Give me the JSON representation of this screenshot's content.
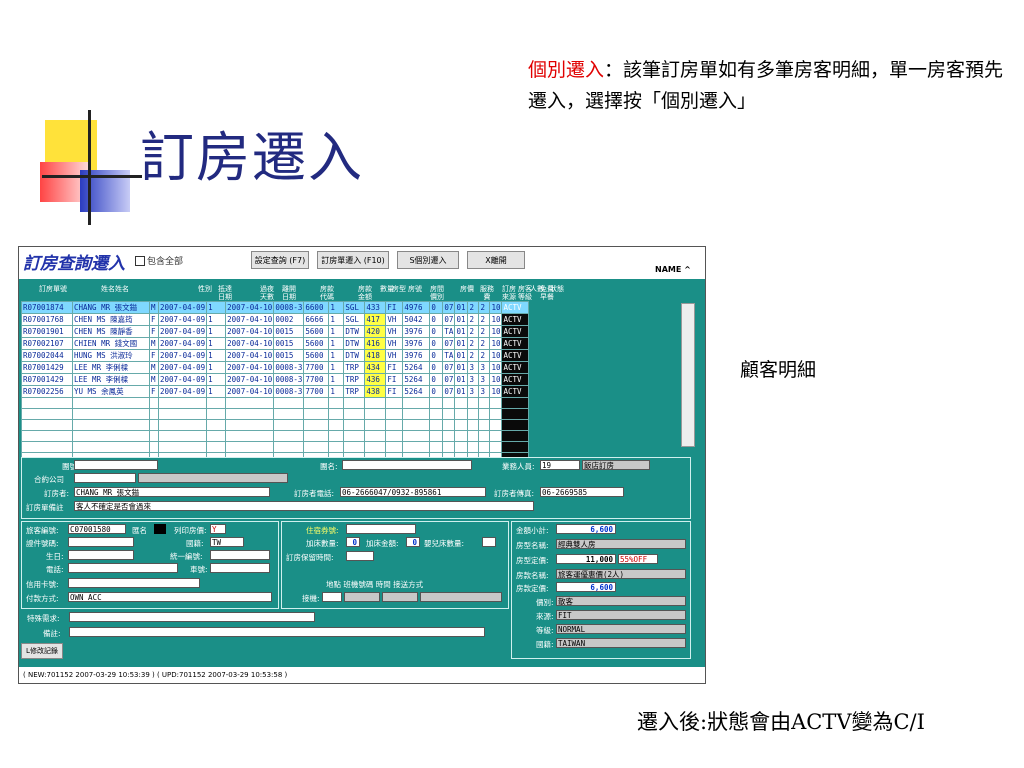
{
  "slide": {
    "title": "訂房遷入",
    "note_top_red": "個別遷入",
    "note_top_rest": "：該筆訂房單如有多筆房客明細，單一房客預先遷入，選擇按「個別遷入」",
    "note_right": "顧客明細",
    "note_bottom": "遷入後:狀態會由ACTV變為C/I"
  },
  "app": {
    "title": "訂房查詢遷入",
    "include_all_label": "包含全部",
    "buttons": {
      "settings": "設定查詢 (F7)",
      "booking_checkin": "訂房單遷入 (F10)",
      "individual_checkin": "S個別遷入",
      "leave": "X離開"
    },
    "name_label": "NAME ^",
    "columns": [
      "訂房單號",
      "姓名姓名",
      "性別",
      "抵達日期",
      "過夜天數",
      "離開日期",
      "房款代碼",
      "房款金額",
      "數量",
      "房型",
      "房號",
      "房間價別",
      "房價",
      "服務費",
      "訂房來源",
      "房客等級",
      "人數",
      "免費早餐",
      "狀態"
    ],
    "rows": [
      [
        "R07001874",
        "CHANG MR 張文鎰",
        "M",
        "2007-04-09",
        "1",
        "2007-04-10",
        "0008-3",
        "6600",
        "1",
        "SGL",
        "433",
        "FI",
        "4976",
        "0",
        "07",
        "01",
        "2",
        "2",
        "10",
        "ACTV"
      ],
      [
        "R07001768",
        "CHEN MS 陳嘉筠",
        "F",
        "2007-04-09",
        "1",
        "2007-04-10",
        "0002",
        "6666",
        "1",
        "SGL",
        "417",
        "VH",
        "5042",
        "0",
        "07",
        "01",
        "2",
        "2",
        "10",
        "ACTV"
      ],
      [
        "R07001901",
        "CHEN MS 陳靜香",
        "F",
        "2007-04-09",
        "1",
        "2007-04-10",
        "0015",
        "5600",
        "1",
        "DTW",
        "420",
        "VH",
        "3976",
        "0",
        "TA",
        "01",
        "2",
        "2",
        "10",
        "ACTV"
      ],
      [
        "R07002107",
        "CHIEN MR 錢文國",
        "M",
        "2007-04-09",
        "1",
        "2007-04-10",
        "0015",
        "5600",
        "1",
        "DTW",
        "416",
        "VH",
        "3976",
        "0",
        "07",
        "01",
        "2",
        "2",
        "10",
        "ACTV"
      ],
      [
        "R07002044",
        "HUNG MS 洪淑玲",
        "F",
        "2007-04-09",
        "1",
        "2007-04-10",
        "0015",
        "5600",
        "1",
        "DTW",
        "418",
        "VH",
        "3976",
        "0",
        "TA",
        "01",
        "2",
        "2",
        "10",
        "ACTV"
      ],
      [
        "R07001429",
        "LEE MR 李俐樑",
        "M",
        "2007-04-09",
        "1",
        "2007-04-10",
        "0008-3",
        "7700",
        "1",
        "TRP",
        "434",
        "FI",
        "5264",
        "0",
        "07",
        "01",
        "3",
        "3",
        "10",
        "ACTV"
      ],
      [
        "R07001429",
        "LEE MR 李俐樑",
        "M",
        "2007-04-09",
        "1",
        "2007-04-10",
        "0008-3",
        "7700",
        "1",
        "TRP",
        "436",
        "FI",
        "5264",
        "0",
        "07",
        "01",
        "3",
        "3",
        "10",
        "ACTV"
      ],
      [
        "R07002256",
        "YU MS 余鳳英",
        "F",
        "2007-04-09",
        "1",
        "2007-04-10",
        "0008-3",
        "7700",
        "1",
        "TRP",
        "438",
        "FI",
        "5264",
        "0",
        "07",
        "01",
        "3",
        "3",
        "10",
        "ACTV"
      ]
    ],
    "mid": {
      "group_label": "團號:",
      "contract_label": "合約公司",
      "booker_label": "訂房者:",
      "booker_value": "CHANG MR 張文鎰",
      "remark_label": "訂房單備註",
      "remark_value": "客人不確定是否會過來",
      "group_name_label": "團名:",
      "sales_label": "業務人員:",
      "sales_value": "19",
      "sales_name": "飯店訂房",
      "booker_phone_label": "訂房者電話:",
      "booker_phone_value": "06-2666047/0932-895861",
      "booker_fax_label": "訂房者傳真:",
      "booker_fax_value": "06-2669585"
    },
    "guest": {
      "guest_no_label": "旅客編號:",
      "guest_no_value": "C07001580",
      "name_label": "匯名",
      "print_label": "列印房價:",
      "print_value": "Y",
      "id_label": "證件號碼:",
      "nation_label": "國籍:",
      "nation_value": "TW",
      "birth_label": "生日:",
      "tax_label": "統一編號:",
      "phone_label": "電話:",
      "car_label": "車號:",
      "card_label": "信用卡號:",
      "pay_label": "付款方式:",
      "pay_value": "OWN ACC",
      "special_label": "特殊需求:",
      "note_label": "備註:",
      "log_button": "L修改記錄"
    },
    "stay": {
      "voucher_label": "住宿券號:",
      "extra_bed_label": "加床數量:",
      "extra_bed_value": "0",
      "extra_amt_label": "加床金額:",
      "extra_amt_value": "0",
      "baby_bed_label": "嬰兒床數量:",
      "hold_label": "訂房保留時間:",
      "pickup_cols": "地點  班機號碼  時間  接送方式",
      "pickup_label": "接機:"
    },
    "price": {
      "subtotal_label": "金額小計:",
      "subtotal_value": "6,600",
      "roomtype_label": "房型名稱:",
      "roomtype_value": "經典雙人房",
      "list_label": "房型定價:",
      "list_value": "11,000",
      "discount_value": "55%OFF",
      "ratename_label": "房款名稱:",
      "ratename_value": "旅客運優惠價(2人)",
      "rateprice_label": "房款定價:",
      "rateprice_value": "6,600",
      "pricetype_label": "價別:",
      "pricetype_value": "散客",
      "source_label": "來源:",
      "source_value": "FIT",
      "grade_label": "等級:",
      "grade_value": "NORMAL",
      "country_label": "國籍:",
      "country_value": "TAIWAN"
    },
    "status_bar": "( NEW:701152 2007-03-29 10:53:39 ) ( UPD:701152 2007-03-29 10:53:58 )"
  }
}
